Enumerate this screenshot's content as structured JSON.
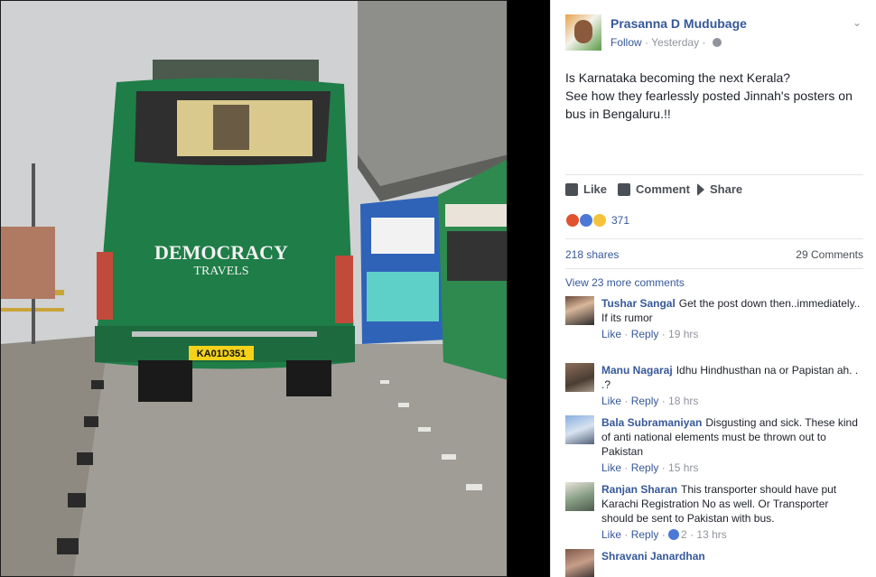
{
  "photo": {
    "bus_brand_line1": "DEMOCRACY",
    "bus_brand_line2": "TRAVELS",
    "bus_plate": "KA01D351",
    "colors": {
      "bus_green": "#1f7d48",
      "sky": "#cfd1d2",
      "road": "#9c9a95"
    }
  },
  "post": {
    "author": "Prasanna D Mudubage",
    "follow": "Follow",
    "time": "Yesterday",
    "icons": {
      "privacy": "globe-icon",
      "menu": "chevron-down-icon"
    },
    "text_line1": "Is Karnataka becoming the next Kerala?",
    "text_line2": "See how they fearlessly posted Jinnah's posters on bus in Bengaluru.!!"
  },
  "actions": {
    "like": "Like",
    "comment": "Comment",
    "share": "Share"
  },
  "reactions": {
    "count": "371",
    "icons": [
      "angry-icon",
      "like-icon",
      "sad-icon"
    ]
  },
  "stats": {
    "shares": "218 shares",
    "comments": "29 Comments"
  },
  "view_more": "View 23 more comments",
  "comments": [
    {
      "name": "Tushar Sangal",
      "text": "Get the post down then..immediately..",
      "text2": "If its rumor",
      "like": "Like",
      "reply": "Reply",
      "time": "19 hrs"
    },
    {
      "name": "Manu Nagaraj",
      "text": "Idhu Hindhusthan na or Papistan ah. . .?",
      "like": "Like",
      "reply": "Reply",
      "time": "18 hrs"
    },
    {
      "name": "Bala Subramaniyan",
      "text": "Disgusting and sick. These kind of anti national elements must be thrown out to Pakistan",
      "like": "Like",
      "reply": "Reply",
      "time": "15 hrs"
    },
    {
      "name": "Ranjan Sharan",
      "text": "This transporter should have put Karachi Registration No as well. Or Transporter should be sent to Pakistan with bus.",
      "like": "Like",
      "reply": "Reply",
      "reacts": "2",
      "time": "13 hrs"
    },
    {
      "name": "Shravani Janardhan"
    }
  ]
}
